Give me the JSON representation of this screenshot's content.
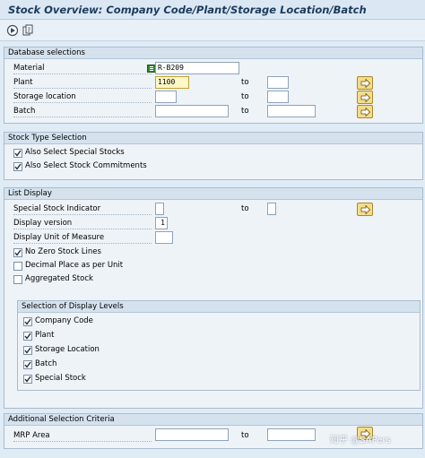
{
  "window": {
    "title": "Stock Overview: Company Code/Plant/Storage Location/Batch"
  },
  "toolbar": {
    "execute_icon": "execute-icon",
    "variant_icon": "get-variant-icon"
  },
  "database_selections": {
    "header": "Database selections",
    "to_label": "to",
    "fields": [
      {
        "label": "Material",
        "value": "R-B209"
      },
      {
        "label": "Plant",
        "value": "1100",
        "to_value": ""
      },
      {
        "label": "Storage location",
        "value": "",
        "to_value": ""
      },
      {
        "label": "Batch",
        "value": "",
        "to_value": ""
      }
    ]
  },
  "stock_type": {
    "header": "Stock Type Selection",
    "options": [
      {
        "label": "Also Select Special Stocks",
        "checked": true
      },
      {
        "label": "Also Select Stock Commitments",
        "checked": true
      }
    ]
  },
  "list_display": {
    "header": "List Display",
    "to_label": "to",
    "fields": [
      {
        "label": "Special Stock Indicator",
        "value": "",
        "to_value": ""
      },
      {
        "label": "Display version",
        "value": "1"
      },
      {
        "label": "Display Unit of Measure",
        "value": ""
      }
    ],
    "options": [
      {
        "label": "No Zero Stock Lines",
        "checked": true
      },
      {
        "label": "Decimal Place as per Unit",
        "checked": false
      },
      {
        "label": "Aggregated Stock",
        "checked": false
      }
    ],
    "display_levels": {
      "header": "Selection of Display Levels",
      "options": [
        {
          "label": "Company Code",
          "checked": true
        },
        {
          "label": "Plant",
          "checked": true
        },
        {
          "label": "Storage Location",
          "checked": true
        },
        {
          "label": "Batch",
          "checked": true
        },
        {
          "label": "Special Stock",
          "checked": true
        }
      ]
    }
  },
  "additional_criteria": {
    "header": "Additional Selection Criteria",
    "to_label": "to",
    "fields": [
      {
        "label": "MRP Area",
        "value": "",
        "to_value": ""
      }
    ]
  },
  "watermark": "知乎 @SAPers"
}
